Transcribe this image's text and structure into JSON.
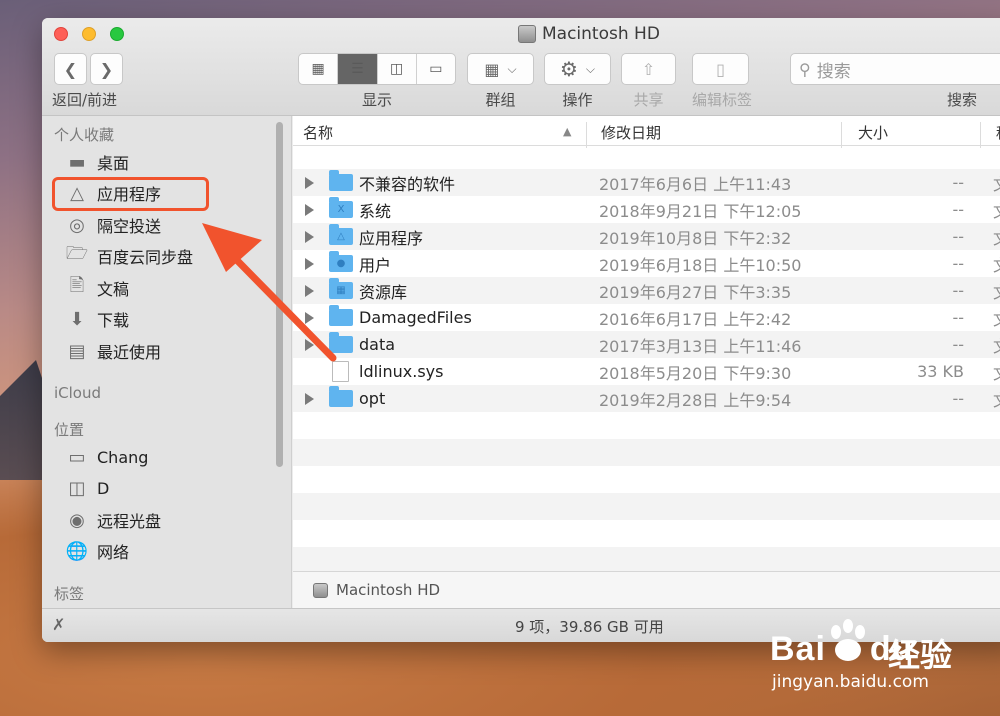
{
  "window": {
    "title": "Macintosh HD"
  },
  "toolbar": {
    "back_forward_label": "返回/前进",
    "view_label": "显示",
    "group_label": "群组",
    "action_label": "操作",
    "share_label": "共享",
    "tags_label": "编辑标签",
    "search_label": "搜索",
    "search_placeholder": "搜索",
    "view_modes": [
      "icon",
      "list",
      "column",
      "gallery"
    ],
    "active_view": "list"
  },
  "sidebar": {
    "favorites_heading": "个人收藏",
    "favorites": [
      {
        "label": "桌面",
        "icon": "desktop-icon"
      },
      {
        "label": "应用程序",
        "icon": "applications-icon",
        "highlighted": true
      },
      {
        "label": "隔空投送",
        "icon": "airdrop-icon"
      },
      {
        "label": "百度云同步盘",
        "icon": "folder-icon"
      },
      {
        "label": "文稿",
        "icon": "documents-icon"
      },
      {
        "label": "下载",
        "icon": "download-icon"
      },
      {
        "label": "最近使用",
        "icon": "recents-icon"
      }
    ],
    "icloud_heading": "iCloud",
    "locations_heading": "位置",
    "locations": [
      {
        "label": "Chang",
        "icon": "laptop-icon"
      },
      {
        "label": "D",
        "icon": "drive-icon"
      },
      {
        "label": "远程光盘",
        "icon": "disc-icon"
      },
      {
        "label": "网络",
        "icon": "network-icon"
      }
    ],
    "tags_heading": "标签"
  },
  "columns": {
    "name": "名称",
    "date": "修改日期",
    "size": "大小",
    "kind": "种"
  },
  "files": [
    {
      "name": "不兼容的软件",
      "date": "2017年6月6日 上午11:43",
      "size": "--",
      "kind": "文",
      "type": "folder"
    },
    {
      "name": "系统",
      "date": "2018年9月21日 下午12:05",
      "size": "--",
      "kind": "文",
      "type": "folder"
    },
    {
      "name": "应用程序",
      "date": "2019年10月8日 下午2:32",
      "size": "--",
      "kind": "文",
      "type": "folder"
    },
    {
      "name": "用户",
      "date": "2019年6月18日 上午10:50",
      "size": "--",
      "kind": "文",
      "type": "folder"
    },
    {
      "name": "资源库",
      "date": "2019年6月27日 下午3:35",
      "size": "--",
      "kind": "文",
      "type": "folder"
    },
    {
      "name": "DamagedFiles",
      "date": "2016年6月17日 上午2:42",
      "size": "--",
      "kind": "文",
      "type": "folder"
    },
    {
      "name": "data",
      "date": "2017年3月13日 上午11:46",
      "size": "--",
      "kind": "文",
      "type": "folder"
    },
    {
      "name": "ldlinux.sys",
      "date": "2018年5月20日 下午9:30",
      "size": "33 KB",
      "kind": "文",
      "type": "file"
    },
    {
      "name": "opt",
      "date": "2019年2月28日 上午9:54",
      "size": "--",
      "kind": "文",
      "type": "folder"
    }
  ],
  "pathbar": {
    "label": "Macintosh HD"
  },
  "status": {
    "text": "9 项，39.86 GB 可用"
  },
  "watermark": {
    "logo": "Bai",
    "logo2": "du",
    "cn": "经验",
    "url": "jingyan.baidu.com"
  },
  "colors": {
    "highlight": "#f1532d",
    "folder": "#5fb4ef",
    "active_segment": "#656565"
  }
}
